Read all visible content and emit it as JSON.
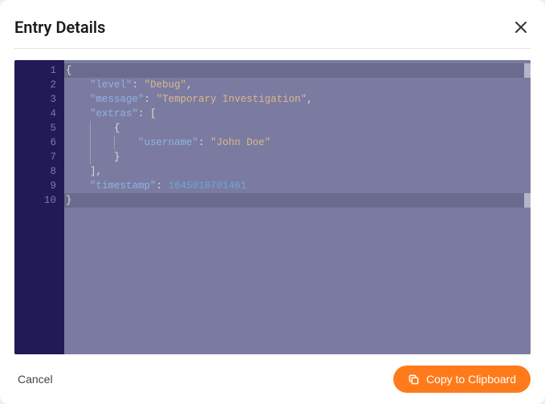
{
  "header": {
    "title": "Entry Details"
  },
  "footer": {
    "cancel_label": "Cancel",
    "copy_label": "Copy to Clipboard"
  },
  "code": {
    "line_count": 10,
    "highlighted_lines": [
      1,
      10
    ],
    "tokens": {
      "brace_open": "{",
      "brace_close": "}",
      "bracket_open": "[",
      "bracket_close": "]",
      "comma": ",",
      "colon": ":",
      "key_level": "\"level\"",
      "val_level": "\"Debug\"",
      "key_message": "\"message\"",
      "val_message": "\"Temporary Investigation\"",
      "key_extras": "\"extras\"",
      "key_username": "\"username\"",
      "val_username": "\"John Doe\"",
      "key_timestamp": "\"timestamp\"",
      "val_timestamp": "1645010701461"
    }
  },
  "icons": {
    "close": "close-icon",
    "copy": "copy-icon"
  },
  "colors": {
    "accent": "#ff7a1a",
    "gutter_bg": "#201b56",
    "code_bg": "#7b7ba1"
  }
}
